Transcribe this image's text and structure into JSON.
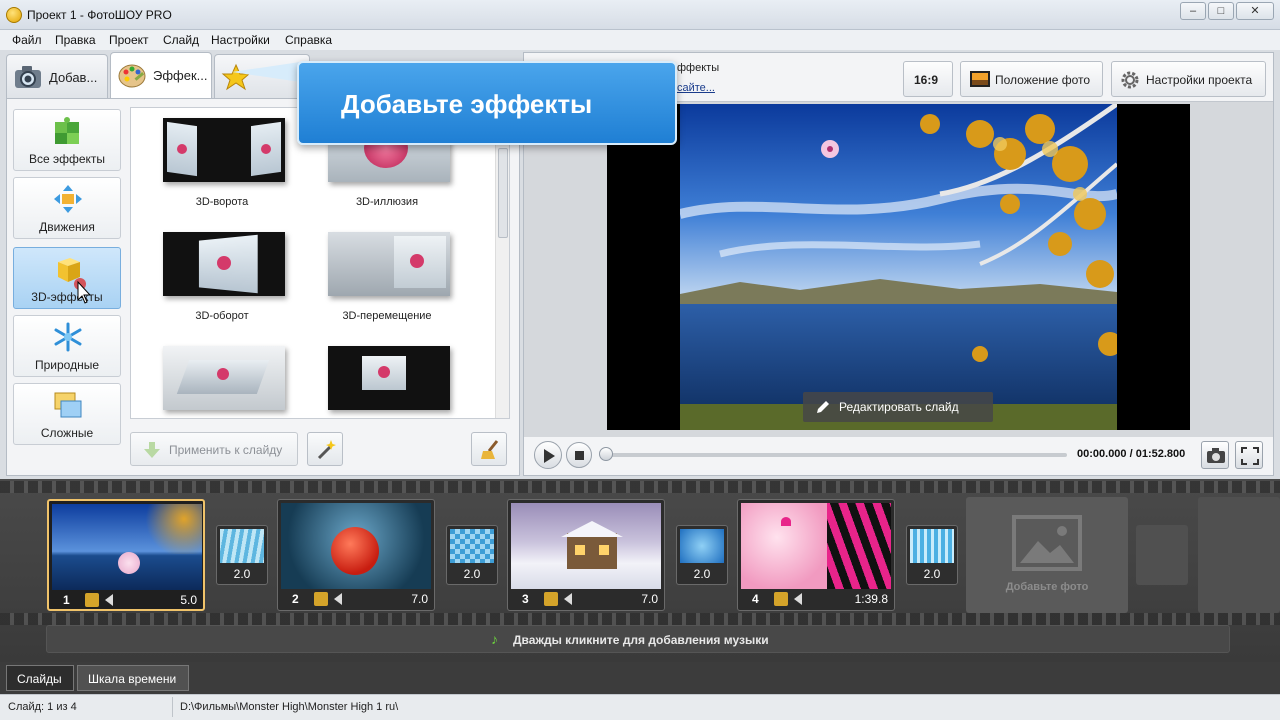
{
  "window": {
    "title": "Проект 1 - ФотоШОУ PRO"
  },
  "menu": [
    "Файл",
    "Правка",
    "Проект",
    "Слайд",
    "Настройки",
    "Справка"
  ],
  "tabs": [
    {
      "label": "Добав...",
      "icon": "camera-icon"
    },
    {
      "label": "Эффек...",
      "icon": "palette-icon"
    },
    {
      "label": "",
      "icon": "star-icon"
    }
  ],
  "categories": [
    {
      "label": "Все эффекты",
      "icon": "puzzle-icon"
    },
    {
      "label": "Движения",
      "icon": "move-arrows-icon"
    },
    {
      "label": "3D-эффекты",
      "icon": "cube-icon"
    },
    {
      "label": "Природные",
      "icon": "snowflake-icon"
    },
    {
      "label": "Сложные",
      "icon": "layers-icon"
    }
  ],
  "effects": [
    {
      "label": "3D-ворота"
    },
    {
      "label": "3D-иллюзия"
    },
    {
      "label": "3D-оборот"
    },
    {
      "label": "3D-перемещение"
    },
    {
      "label": ""
    },
    {
      "label": ""
    }
  ],
  "left_panel": {
    "apply_label": "Применить к слайду"
  },
  "tooltip": {
    "text": "Добавьте эффекты"
  },
  "preview": {
    "hint_text": "ффекты",
    "hint_link": "сайте...",
    "aspect_label": "16:9",
    "photo_position_label": "Положение фото",
    "project_settings_label": "Настройки проекта",
    "edit_slide_label": "Редактировать слайд",
    "time": "00:00.000 / 01:52.800"
  },
  "slides": [
    {
      "number": "1",
      "duration": "5.0"
    },
    {
      "number": "2",
      "duration": "7.0"
    },
    {
      "number": "3",
      "duration": "7.0"
    },
    {
      "number": "4",
      "duration": "1:39.8"
    }
  ],
  "transitions": [
    {
      "duration": "2.0"
    },
    {
      "duration": "2.0"
    },
    {
      "duration": "2.0"
    },
    {
      "duration": "2.0"
    }
  ],
  "timeline": {
    "add_photo_label": "Добавьте фото",
    "music_hint": "Дважды кликните для добавления музыки"
  },
  "bottom_tabs": [
    "Слайды",
    "Шкала времени"
  ],
  "status": {
    "slide_info": "Слайд: 1 из 4",
    "path": "D:\\Фильмы\\Monster High\\Monster High 1  ru\\"
  },
  "colors": {
    "accent_blue": "#2a8ae0",
    "selected_slide_border": "#f0c36a",
    "music_note": "#6bcf3e"
  }
}
